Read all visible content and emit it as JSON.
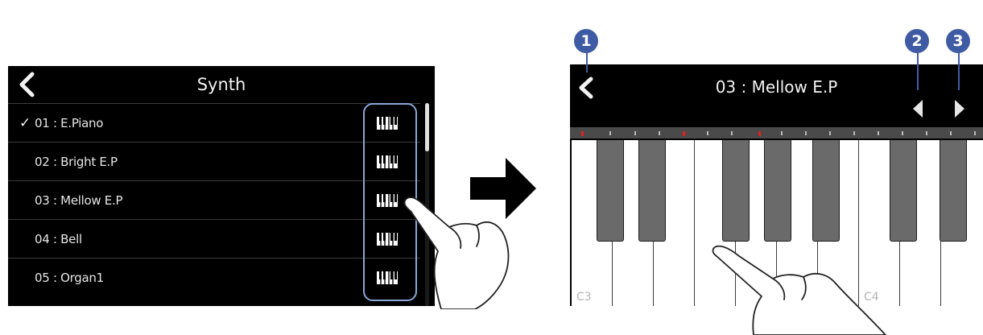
{
  "left_screen": {
    "title": "Synth",
    "check_mark": "✓",
    "presets": [
      {
        "label": "01 : E.Piano",
        "selected": true
      },
      {
        "label": "02 : Bright E.P",
        "selected": false
      },
      {
        "label": "03 : Mellow E.P",
        "selected": false
      },
      {
        "label": "04 : Bell",
        "selected": false
      },
      {
        "label": "05 : Organ1",
        "selected": false
      }
    ]
  },
  "right_screen": {
    "title": "03 : Mellow E.P",
    "note_labels": {
      "c3": "C3",
      "c4": "C4"
    }
  },
  "callouts": {
    "one": "1",
    "two": "2",
    "three": "3"
  },
  "colors": {
    "screen_bg": "#000000",
    "callout": "#3f5ba3",
    "highlight_border": "#8aa7d8",
    "range_marker": "#e02020"
  },
  "icons": {
    "back": "chevron-left-icon",
    "keyboard": "keyboard-icon",
    "prev": "triangle-left-icon",
    "next": "triangle-right-icon",
    "transition": "arrow-right-icon",
    "gesture": "pointing-hand-icon"
  }
}
